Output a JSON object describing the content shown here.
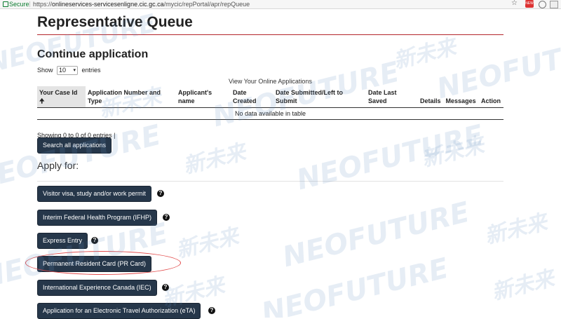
{
  "browser": {
    "secure_label": "Secure",
    "url_prefix": "https://",
    "url_host": "onlineservices-servicesenligne.cic.gc.ca",
    "url_path": "/mycic/repPortal/apr/repQueue",
    "ext_badge": "NEW"
  },
  "page": {
    "title": "Representative Queue",
    "section_title": "Continue application",
    "show_label": "Show",
    "entries_value": "10",
    "entries_label": "entries",
    "table_caption": "View Your Online Applications",
    "columns": [
      "Your Case Id",
      "Application Number and Type",
      "Applicant's name",
      "Date Created",
      "Date Submitted/Left to Submit",
      "Date Last Saved",
      "Details",
      "Messages",
      "Action"
    ],
    "sort_icon": "🠉",
    "empty_message": "No data available in table",
    "info_text": "Showing 0 to 0 of 0 entries |",
    "search_button": "Search all applications",
    "apply_for": "Apply for:",
    "apply_buttons": [
      "Visitor visa, study and/or work permit",
      "Interim Federal Health Program (IFHP)",
      "Express Entry",
      "Permanent Resident Card (PR Card)",
      "International Experience Canada (IEC)",
      "Application for an Electronic Travel Authorization (eTA)"
    ],
    "help_glyph": "?"
  },
  "watermark": {
    "latin": "NEOFUTURE",
    "cjk": "新未来"
  }
}
